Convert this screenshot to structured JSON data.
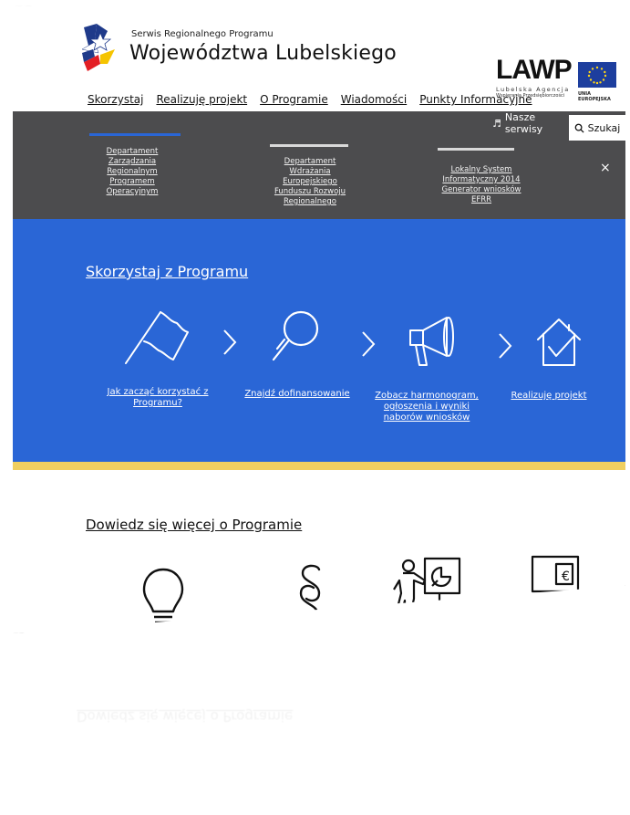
{
  "brand": {
    "small": "Serwis Regionalnego Programu",
    "big": "Województwa Lubelskiego"
  },
  "partner_logo": {
    "word": "LAWP",
    "sub1": "Lubelska Agencja",
    "sub2": "Wspierania Przedsiębiorczości"
  },
  "eu_logo": {
    "label": "UNIA EUROPEJSKA"
  },
  "nav": {
    "items": [
      "Skorzystaj",
      "Realizuję projekt",
      "O Programie",
      "Wiadomości",
      "Punkty Informacyjne"
    ],
    "services_label": "Nasze serwisy",
    "search_label": "Szukaj"
  },
  "dropdown": {
    "col1": "Departament Zarządzania Regionalnym Programem Operacyjnym",
    "col2": "Departament Wdrażania Europejskiego Funduszu Rozwoju Regionalnego",
    "col3": "Lokalny System Informatyczny 2014 Generator wniosków EFRR",
    "close": "×"
  },
  "program": {
    "title": "Skorzystaj z Programu",
    "steps": [
      {
        "icon": "flag-icon",
        "label": "Jak zacząć korzystać z Programu?"
      },
      {
        "icon": "magnifier-icon",
        "label": "Znajdź dofinansowanie"
      },
      {
        "icon": "megaphone-icon",
        "label": "Zobacz harmonogram, ogłoszenia i wyniki naborów wniosków"
      },
      {
        "icon": "house-check-icon",
        "label": "Realizuję projekt"
      }
    ]
  },
  "more": {
    "title": "Dowiedz się więcej o Programie",
    "icons": [
      "lightbulb-icon",
      "paragraph-icon",
      "presentation-icon",
      "euro-screen-icon"
    ]
  },
  "colors": {
    "blue": "#2a66d6",
    "grey": "#4c4c4e",
    "yellow": "#f0cf60"
  }
}
